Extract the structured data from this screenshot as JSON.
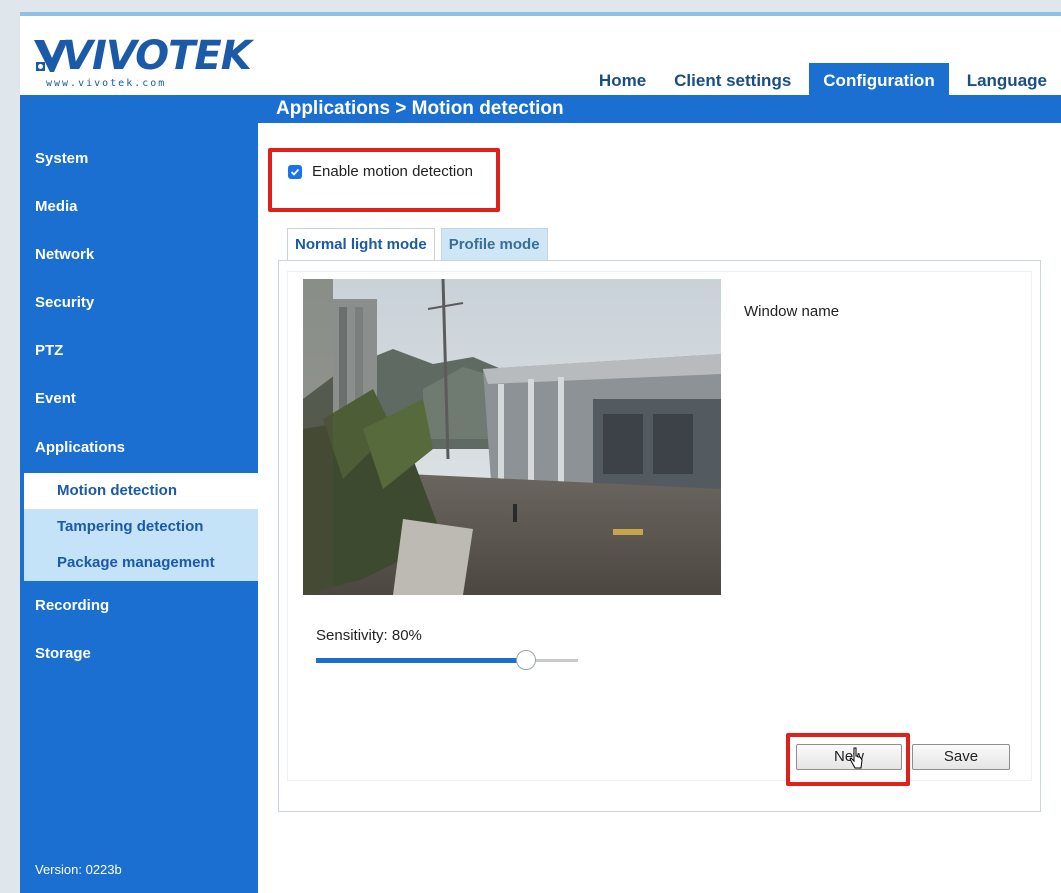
{
  "header": {
    "logo_text": "VIVOTEK",
    "logo_url": "www.vivotek.com",
    "nav": [
      {
        "label": "Home",
        "active": false
      },
      {
        "label": "Client settings",
        "active": false
      },
      {
        "label": "Configuration",
        "active": true
      },
      {
        "label": "Language",
        "active": false
      }
    ]
  },
  "breadcrumb": "Applications  > Motion detection",
  "sidebar": {
    "items": [
      {
        "label": "System"
      },
      {
        "label": "Media"
      },
      {
        "label": "Network"
      },
      {
        "label": "Security"
      },
      {
        "label": "PTZ"
      },
      {
        "label": "Event"
      },
      {
        "label": "Applications"
      }
    ],
    "subitems": [
      {
        "label": "Motion detection",
        "active": true
      },
      {
        "label": "Tampering detection",
        "active": false
      },
      {
        "label": "Package management",
        "active": false
      }
    ],
    "items_after": [
      {
        "label": "Recording"
      },
      {
        "label": "Storage"
      }
    ],
    "version": "Version: 0223b"
  },
  "content": {
    "enable_label": "Enable motion detection",
    "enable_checked": true,
    "tabs": [
      {
        "label": "Normal light mode",
        "active": true
      },
      {
        "label": "Profile mode",
        "active": false
      }
    ],
    "window_name_label": "Window name",
    "sensitivity_label": "Sensitivity: 80%",
    "sensitivity_value": 0.8,
    "new_button": "New",
    "save_button": "Save"
  },
  "colors": {
    "brand_blue": "#1b6fd0",
    "highlight_red": "#e0201b",
    "submenu_bg": "#c4e2f8"
  }
}
